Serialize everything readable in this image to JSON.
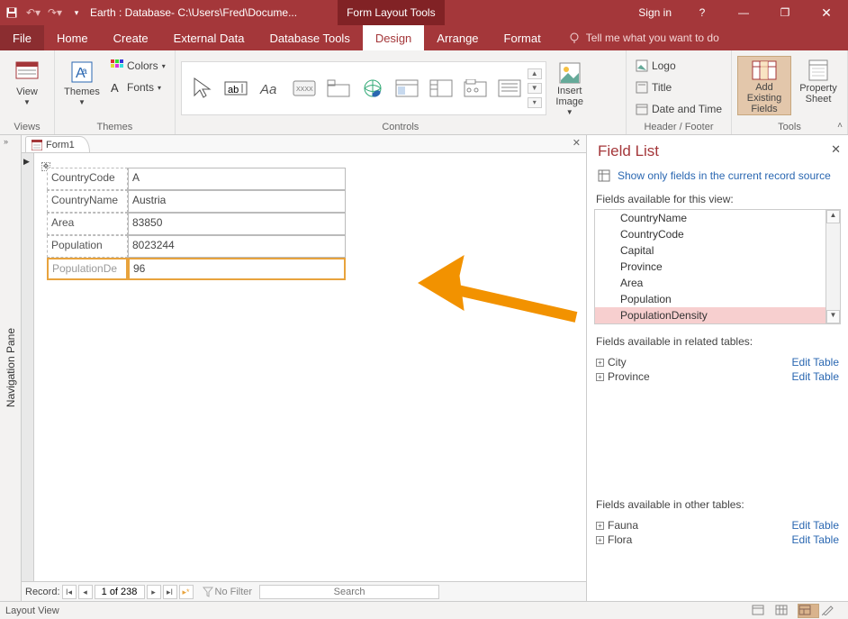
{
  "titlebar": {
    "doc_title": "Earth : Database- C:\\Users\\Fred\\Docume...",
    "tool_context": "Form Layout Tools",
    "sign_in": "Sign in"
  },
  "menu": {
    "file": "File",
    "home": "Home",
    "create": "Create",
    "external": "External Data",
    "dbtools": "Database Tools",
    "design": "Design",
    "arrange": "Arrange",
    "format": "Format",
    "tellme": "Tell me what you want to do"
  },
  "ribbon": {
    "views_group": "Views",
    "view_btn": "View",
    "themes_group": "Themes",
    "themes_btn": "Themes",
    "colors_btn": "Colors",
    "fonts_btn": "Fonts",
    "controls_group": "Controls",
    "insert_image_btn": "Insert Image",
    "headerfooter_group": "Header / Footer",
    "logo_btn": "Logo",
    "title_btn": "Title",
    "datetime_btn": "Date and Time",
    "tools_group": "Tools",
    "add_fields_btn": "Add Existing Fields",
    "prop_sheet_btn": "Property Sheet"
  },
  "navpane": {
    "label": "Navigation Pane"
  },
  "doc_tab": {
    "name": "Form1"
  },
  "form": {
    "fields": [
      {
        "label": "CountryCode",
        "value": "A"
      },
      {
        "label": "CountryName",
        "value": "Austria"
      },
      {
        "label": "Area",
        "value": "83850"
      },
      {
        "label": "Population",
        "value": "8023244"
      },
      {
        "label": "PopulationDe",
        "value": "96"
      }
    ]
  },
  "recordnav": {
    "label": "Record:",
    "position": "1 of 238",
    "no_filter": "No Filter",
    "search_placeholder": "Search"
  },
  "fieldlist": {
    "title": "Field List",
    "show_only_link": "Show only fields in the current record source",
    "avail_view": "Fields available for this view:",
    "view_fields": [
      "CountryName",
      "CountryCode",
      "Capital",
      "Province",
      "Area",
      "Population",
      "PopulationDensity"
    ],
    "avail_related": "Fields available in related tables:",
    "related": [
      "City",
      "Province"
    ],
    "avail_other": "Fields available in other tables:",
    "other": [
      "Fauna",
      "Flora"
    ],
    "edit_table": "Edit Table"
  },
  "statusbar": {
    "mode": "Layout View"
  }
}
